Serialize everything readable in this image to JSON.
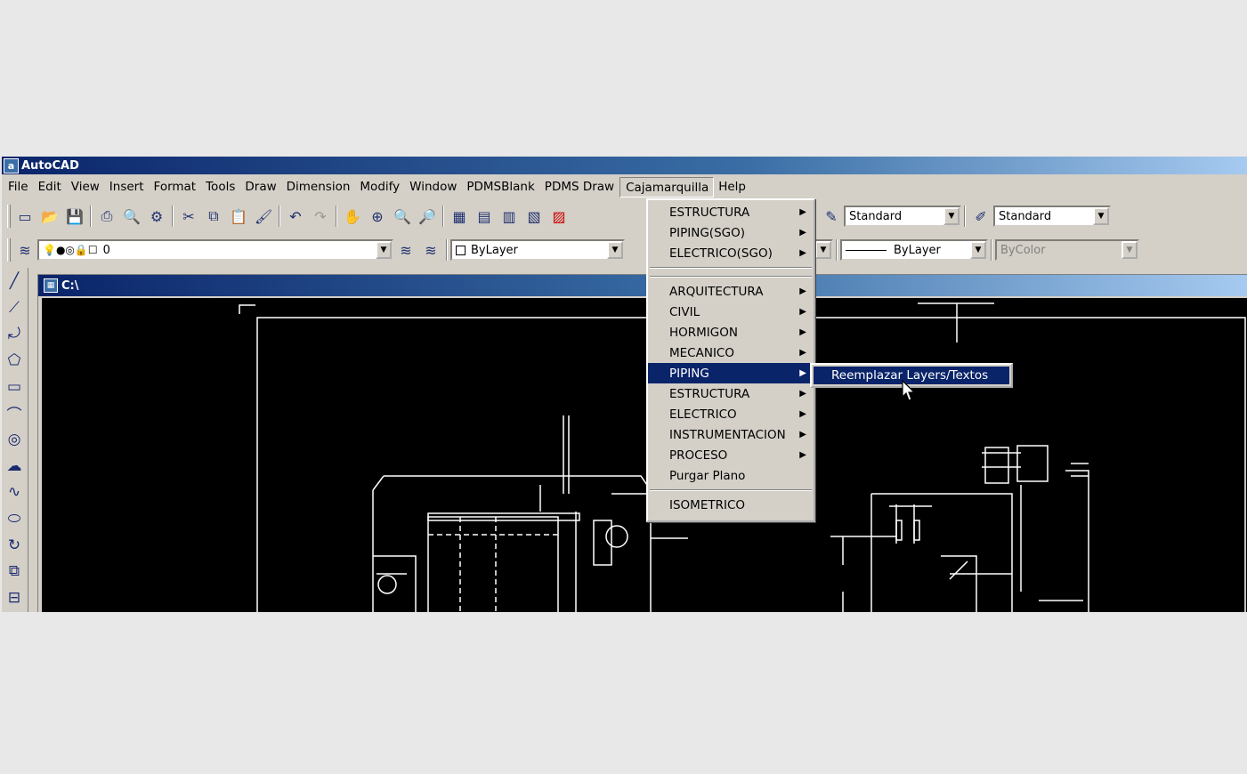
{
  "window": {
    "title": "AutoCAD"
  },
  "menubar": {
    "items": [
      {
        "label": "File"
      },
      {
        "label": "Edit"
      },
      {
        "label": "View"
      },
      {
        "label": "Insert"
      },
      {
        "label": "Format"
      },
      {
        "label": "Tools"
      },
      {
        "label": "Draw"
      },
      {
        "label": "Dimension"
      },
      {
        "label": "Modify"
      },
      {
        "label": "Window"
      },
      {
        "label": "PDMSBlank"
      },
      {
        "label": "PDMS Draw"
      },
      {
        "label": "Cajamarquilla"
      },
      {
        "label": "Help"
      }
    ],
    "active": "Cajamarquilla"
  },
  "toolbar1": {
    "text_style_value": "Standard",
    "dim_style_value": "Standard"
  },
  "toolbar2": {
    "layer_value": "0",
    "color_value": "ByLayer",
    "linetype_value": "ByLayer",
    "plotstyle_value": "ByColor"
  },
  "drawing_window": {
    "title": "C:\\"
  },
  "cajamarquilla_menu": {
    "group1": [
      {
        "label": "ESTRUCTURA",
        "submenu": true
      },
      {
        "label": "PIPING(SGO)",
        "submenu": true
      },
      {
        "label": "ELECTRICO(SGO)",
        "submenu": true
      }
    ],
    "group2": [
      {
        "label": "ARQUITECTURA",
        "submenu": true
      },
      {
        "label": "CIVIL",
        "submenu": true
      },
      {
        "label": "HORMIGON",
        "submenu": true
      },
      {
        "label": "MECANICO",
        "submenu": true
      },
      {
        "label": "PIPING",
        "submenu": true,
        "highlighted": true
      },
      {
        "label": "ESTRUCTURA",
        "submenu": true
      },
      {
        "label": "ELECTRICO",
        "submenu": true
      },
      {
        "label": "INSTRUMENTACION",
        "submenu": true
      },
      {
        "label": "PROCESO",
        "submenu": true
      },
      {
        "label": "Purgar Plano",
        "submenu": false
      }
    ],
    "group3": [
      {
        "label": "ISOMETRICO",
        "submenu": false
      }
    ]
  },
  "piping_submenu": {
    "item": "Reemplazar Layers/Textos"
  },
  "colors": {
    "titlebar": "#0a246a",
    "menu_bg": "#d4d0c8",
    "highlight": "#0a246a",
    "canvas": "#000000"
  }
}
